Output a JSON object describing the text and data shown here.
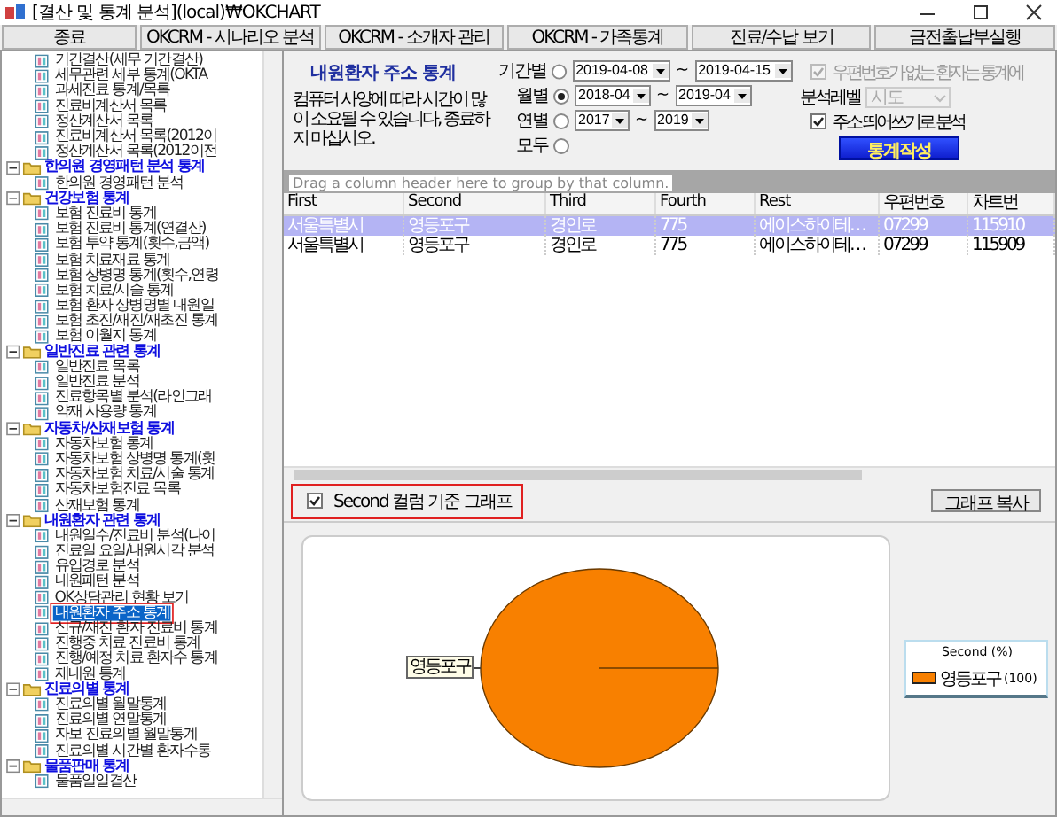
{
  "window": {
    "title": "[결산 및 통계 분석](local)₩OKCHART"
  },
  "toolbar": {
    "buttons": [
      "종료",
      "OKCRM - 시나리오 분석",
      "OKCRM - 소개자 관리",
      "OKCRM - 가족통계",
      "진료/수납 보기",
      "금전출납부실행"
    ]
  },
  "tree": {
    "items": [
      {
        "kind": "leaf",
        "label": "기간결산(세무 기간결산)",
        "selected": false,
        "highlighted": false
      },
      {
        "kind": "leaf",
        "label": "세무관련 세부 통계(OKTA",
        "selected": false,
        "highlighted": false
      },
      {
        "kind": "leaf",
        "label": "과세진료 통계/목록",
        "selected": false,
        "highlighted": false
      },
      {
        "kind": "leaf",
        "label": "진료비계산서 목록",
        "selected": false,
        "highlighted": false
      },
      {
        "kind": "leaf",
        "label": "정산계산서 목록",
        "selected": false,
        "highlighted": false
      },
      {
        "kind": "leaf",
        "label": "진료비계산서 목록(2012이",
        "selected": false,
        "highlighted": false
      },
      {
        "kind": "leaf",
        "label": "정산계산서 목록(2012이전",
        "selected": false,
        "highlighted": false
      },
      {
        "kind": "group",
        "label": "한의원 경영패턴 분석 통계",
        "expanded": true,
        "children": [
          {
            "kind": "leaf",
            "label": "한의원 경영패턴 분석",
            "selected": false,
            "highlighted": false
          }
        ]
      },
      {
        "kind": "group",
        "label": "건강보험 통계",
        "expanded": true,
        "children": [
          {
            "kind": "leaf",
            "label": "보험 진료비 통계",
            "selected": false,
            "highlighted": false
          },
          {
            "kind": "leaf",
            "label": "보험 진료비 통계(연결산)",
            "selected": false,
            "highlighted": false
          },
          {
            "kind": "leaf",
            "label": "보험 투약 통계(횟수,금액)",
            "selected": false,
            "highlighted": false
          },
          {
            "kind": "leaf",
            "label": "보험 치료재료 통계",
            "selected": false,
            "highlighted": false
          },
          {
            "kind": "leaf",
            "label": "보험 상병명 통계(횟수,연령",
            "selected": false,
            "highlighted": false
          },
          {
            "kind": "leaf",
            "label": "보험 치료/시술 통계",
            "selected": false,
            "highlighted": false
          },
          {
            "kind": "leaf",
            "label": "보험 환자 상병명별 내원일",
            "selected": false,
            "highlighted": false
          },
          {
            "kind": "leaf",
            "label": "보험 초진/재진/재초진 통계",
            "selected": false,
            "highlighted": false
          },
          {
            "kind": "leaf",
            "label": "보험 이월지 통계",
            "selected": false,
            "highlighted": false
          }
        ]
      },
      {
        "kind": "group",
        "label": "일반진료 관련 통계",
        "expanded": true,
        "children": [
          {
            "kind": "leaf",
            "label": "일반진료 목록",
            "selected": false,
            "highlighted": false
          },
          {
            "kind": "leaf",
            "label": "일반진료 분석",
            "selected": false,
            "highlighted": false
          },
          {
            "kind": "leaf",
            "label": "진료항목별 분석(라인그래",
            "selected": false,
            "highlighted": false
          },
          {
            "kind": "leaf",
            "label": "약재 사용량 통계",
            "selected": false,
            "highlighted": false
          }
        ]
      },
      {
        "kind": "group",
        "label": "자동차/산재보험 통계",
        "expanded": true,
        "children": [
          {
            "kind": "leaf",
            "label": "자동차보험 통계",
            "selected": false,
            "highlighted": false
          },
          {
            "kind": "leaf",
            "label": "자동차보험 상병명 통계(횟",
            "selected": false,
            "highlighted": false
          },
          {
            "kind": "leaf",
            "label": "자동차보험 치료/시술 통계",
            "selected": false,
            "highlighted": false
          },
          {
            "kind": "leaf",
            "label": "자동차보험진료 목록",
            "selected": false,
            "highlighted": false
          },
          {
            "kind": "leaf",
            "label": "산재보험 통계",
            "selected": false,
            "highlighted": false
          }
        ]
      },
      {
        "kind": "group",
        "label": "내원환자 관련 통계",
        "expanded": true,
        "children": [
          {
            "kind": "leaf",
            "label": "내원일수/진료비 분석(나이",
            "selected": false,
            "highlighted": false
          },
          {
            "kind": "leaf",
            "label": "진료일 요일/내원시각 분석",
            "selected": false,
            "highlighted": false
          },
          {
            "kind": "leaf",
            "label": "유입경로 분석",
            "selected": false,
            "highlighted": false
          },
          {
            "kind": "leaf",
            "label": "내원패턴 분석",
            "selected": false,
            "highlighted": false
          },
          {
            "kind": "leaf",
            "label": "OK상담관리 현황 보기",
            "selected": false,
            "highlighted": false
          },
          {
            "kind": "leaf",
            "label": "내원환자 주소 통계",
            "selected": true,
            "highlighted": true
          },
          {
            "kind": "leaf",
            "label": "신규/재진 환자 진료비 통계",
            "selected": false,
            "highlighted": false
          },
          {
            "kind": "leaf",
            "label": "진행중 치료 진료비 통계",
            "selected": false,
            "highlighted": false
          },
          {
            "kind": "leaf",
            "label": "진행/예정 치료 환자수 통계",
            "selected": false,
            "highlighted": false
          },
          {
            "kind": "leaf",
            "label": "재내원 통계",
            "selected": false,
            "highlighted": false
          }
        ]
      },
      {
        "kind": "group",
        "label": "진료의별 통계",
        "expanded": true,
        "children": [
          {
            "kind": "leaf",
            "label": "진료의별 월말통계",
            "selected": false,
            "highlighted": false
          },
          {
            "kind": "leaf",
            "label": "진료의별 연말통계",
            "selected": false,
            "highlighted": false
          },
          {
            "kind": "leaf",
            "label": "자보 진료의별 월말통계",
            "selected": false,
            "highlighted": false
          },
          {
            "kind": "leaf",
            "label": "진료의별 시간별 환자수통",
            "selected": false,
            "highlighted": false
          }
        ]
      },
      {
        "kind": "group",
        "label": "물품판매 통계",
        "expanded": true,
        "children": [
          {
            "kind": "leaf",
            "label": "물품일일결산",
            "selected": false,
            "highlighted": false
          }
        ]
      }
    ]
  },
  "report": {
    "title": "내원환자 주소 통계",
    "note": "컴퓨터 사양에 따라 시간이 많이 소요될 수 있습니다, 종료하지 마십시오.",
    "periods": [
      {
        "label": "기간별",
        "selected": false,
        "from": "2019-04-08",
        "separator": "~",
        "to": "2019-04-15"
      },
      {
        "label": "월별",
        "selected": true,
        "from": "2018-04",
        "separator": "~",
        "to": "2019-04"
      },
      {
        "label": "연별",
        "selected": false,
        "from": "2017",
        "separator": "~",
        "to": "2019"
      },
      {
        "label": "모두",
        "selected": false
      }
    ],
    "options": [
      {
        "kind": "checkbox",
        "label": "우편번호가 없는 환자는 통계에",
        "checked": true,
        "disabled": true
      },
      {
        "kind": "select",
        "label": "분석레벨",
        "value": "시도",
        "disabled": true
      },
      {
        "kind": "checkbox",
        "label": "주소 띄어쓰기로 분석",
        "checked": true,
        "disabled": false
      }
    ],
    "run_button": "통계작성"
  },
  "grid": {
    "group_hint": "Drag a column header here to group by that column.",
    "columns": [
      "First",
      "Second",
      "Third",
      "Fourth",
      "Rest",
      "우편번호",
      "차트번"
    ],
    "rows": [
      {
        "selected": true,
        "cells": [
          "서울특별시",
          "영등포구",
          "경인로",
          "775",
          "에이스하이테…",
          "07299",
          "115910"
        ]
      },
      {
        "selected": false,
        "cells": [
          "서울특별시",
          "영등포구",
          "경인로",
          "775",
          "에이스하이테…",
          "07299",
          "115909"
        ]
      }
    ]
  },
  "graph": {
    "checkbox": {
      "label": "Second 컬럼 기준 그래프",
      "checked": true,
      "highlighted": true
    },
    "copy_button": "그래프 복사",
    "chart_data": {
      "type": "pie",
      "categories": [
        "영등포구"
      ],
      "series": [
        {
          "name": "Second (%)",
          "color": "#f88000",
          "values": [
            100
          ]
        }
      ]
    },
    "legend": {
      "items": [
        {
          "label": "영등포구",
          "value": "(100)",
          "color": "#f88000"
        }
      ]
    }
  }
}
